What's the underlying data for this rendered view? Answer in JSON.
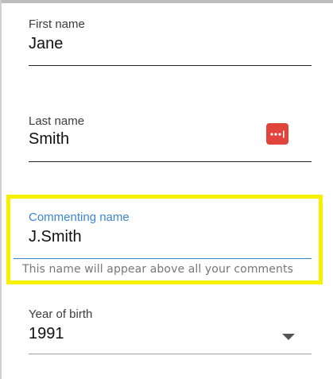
{
  "form": {
    "first_name": {
      "label": "First name",
      "value": "Jane"
    },
    "last_name": {
      "label": "Last name",
      "value": "Smith",
      "icon": "password-manager-icon",
      "icon_color": "#e0443c"
    },
    "commenting_name": {
      "label": "Commenting name",
      "value": "J.Smith",
      "helper": "This name will appear above all your comments",
      "accent_color": "#3b86d1",
      "highlight_color": "#f7f100"
    },
    "year_of_birth": {
      "label": "Year of birth",
      "value": "1991",
      "icon": "chevron-down-icon"
    }
  }
}
